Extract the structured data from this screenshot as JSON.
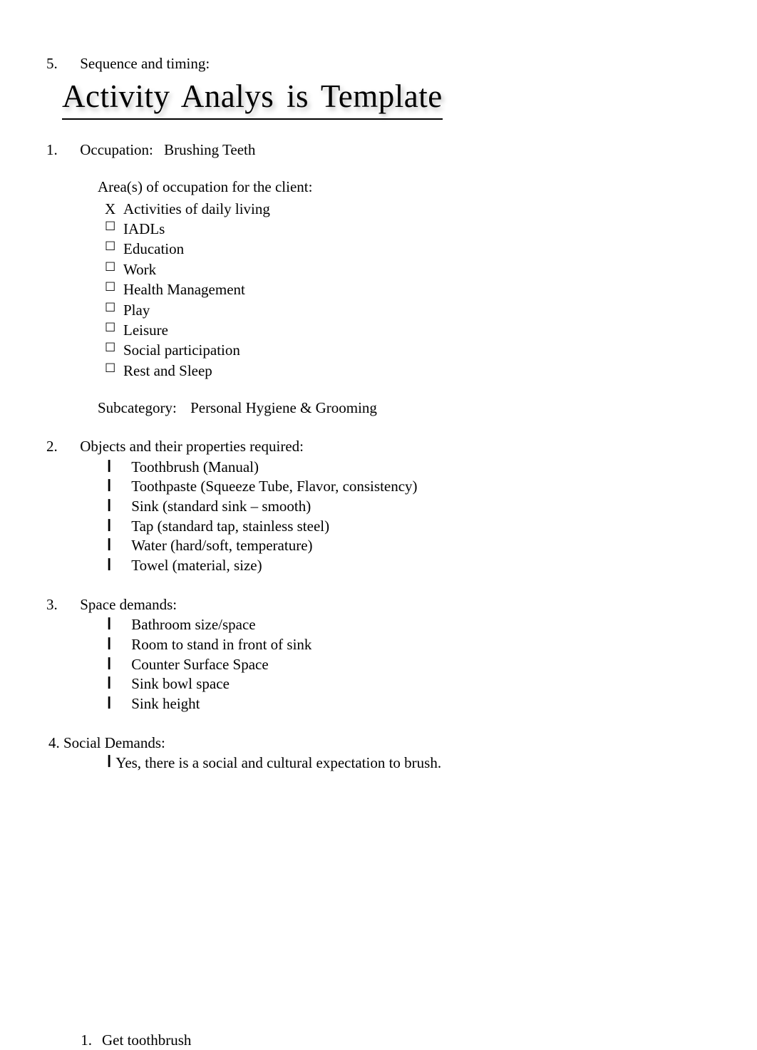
{
  "top": {
    "number": "5.",
    "label": "Sequence and timing:"
  },
  "title": "Activity Analys is Template",
  "s1": {
    "number": "1.",
    "occLabel": "Occupation:",
    "occValue": "Brushing Teeth",
    "areasHeading": "Area(s) of occupation for the client:",
    "checks": [
      {
        "mark": "X",
        "label": "Activities of daily living"
      },
      {
        "mark": "☐",
        "label": "IADLs"
      },
      {
        "mark": "☐",
        "label": "Education"
      },
      {
        "mark": "☐",
        "label": "Work"
      },
      {
        "mark": "☐",
        "label": "Health Management"
      },
      {
        "mark": "☐",
        "label": "Play"
      },
      {
        "mark": "☐",
        "label": "Leisure"
      },
      {
        "mark": "☐",
        "label": "Social participation"
      },
      {
        "mark": "☐",
        "label": "Rest and Sleep"
      }
    ],
    "subcatLabel": "Subcategory:",
    "subcatValue": "Personal Hygiene & Grooming"
  },
  "s2": {
    "number": "2.",
    "heading": "Objects and their properties required:",
    "items": [
      "Toothbrush (Manual)",
      "Toothpaste (Squeeze Tube, Flavor, consistency)",
      "Sink (standard sink – smooth)",
      "Tap (standard tap, stainless steel)",
      "Water (hard/soft, temperature)",
      "Towel (material, size)"
    ]
  },
  "s3": {
    "number": "3.",
    "heading": "Space demands:",
    "items": [
      "Bathroom size/space",
      "Room to stand in front of sink",
      "Counter Surface Space",
      "Sink bowl space",
      "Sink height"
    ]
  },
  "s4": {
    "heading": "4. Social Demands:",
    "text": "Yes, there is a social and cultural expectation to brush."
  },
  "bottom": {
    "number": "1.",
    "text": "Get toothbrush"
  },
  "glyph": "❙"
}
